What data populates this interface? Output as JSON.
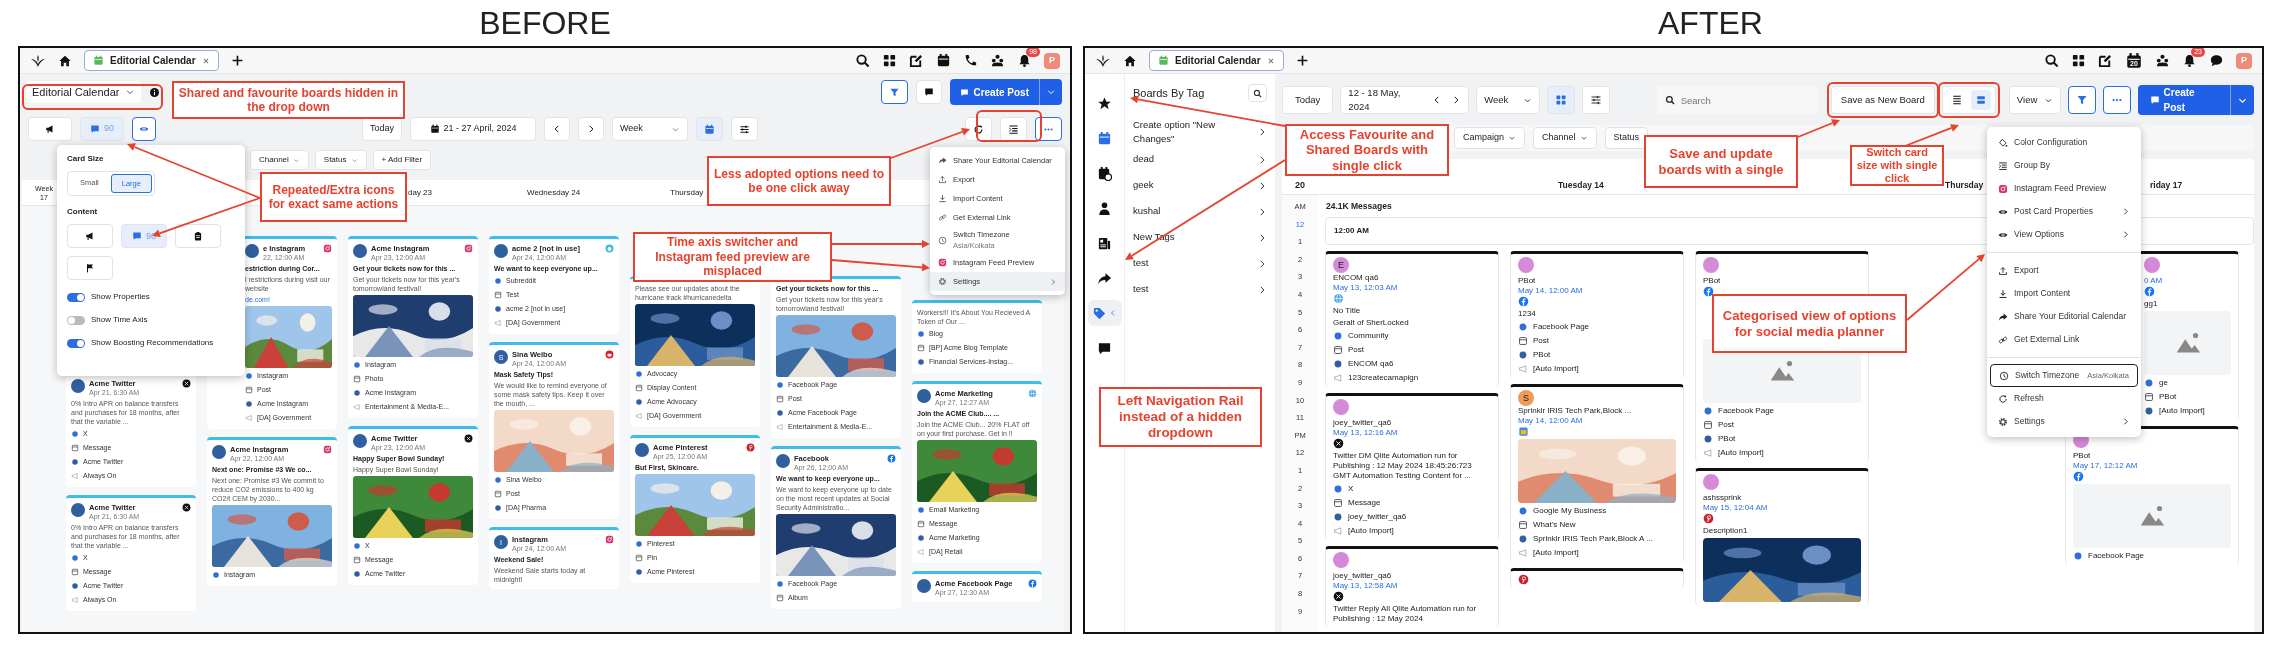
{
  "before": {
    "heading": "BEFORE",
    "topbar": {
      "tab": "Editorial Calendar",
      "badge": "98",
      "avatar": "P"
    },
    "board_selector": "Editorial Calendar",
    "content_buttons": [
      {
        "kind": "megaphone",
        "selected": false
      },
      {
        "kind": "comment",
        "count": "90",
        "selected": false
      },
      {
        "kind": "eye",
        "selected": true
      }
    ],
    "today": "Today",
    "date_range": "21 - 27 April, 2024",
    "view": "Week",
    "create_post": "Create Post",
    "filters": [
      "Channel",
      "Status",
      "+ Add Filter"
    ],
    "week": {
      "label": "Week",
      "number": "17"
    },
    "days": [
      "day 23",
      "Wednesday 24",
      "Thursday"
    ],
    "columns": [
      [
        {
          "name": "Acme Twitter",
          "date": "Apr 21, 6:30 AM",
          "kind": "x",
          "body": "0% Intro APR on balance transfers and purchases for 18 months, after that the variable ...",
          "props": [
            "X",
            "Message",
            "Acme Twitter",
            "Always On"
          ]
        },
        {
          "name": "Acme Twitter",
          "date": "Apr 21, 6:30 AM",
          "kind": "x",
          "body": "0% Intro APR on balance transfers and purchases for 18 months, after that the variable ...",
          "props": [
            "X",
            "Message",
            "Acme Twitter",
            "Always On"
          ]
        }
      ],
      [
        {
          "name": "e Instagram",
          "date": "22, 12:00 AM",
          "kind": "instagram",
          "title": "estriction during Cor...",
          "body": "l restrictions during visit our website",
          "link": "de.com!",
          "media": {
            "kind": "picture"
          },
          "props": [
            "Instagram",
            "Post",
            "Acme Instagram",
            "[DA] Government"
          ]
        },
        {
          "name": "Acme Instagram",
          "date": "Apr 22, 12:00 AM",
          "kind": "instagram",
          "title": "Next one: Promise #3 We co...",
          "body": "Next one: Promise #3 We commit to reduce CO2 emissions to 400 kg CO2/t CEM by 2030...",
          "media": {
            "kind": "picture"
          },
          "props": [
            "Instagram"
          ]
        }
      ],
      [
        {
          "name": "Acme Instagram",
          "date": "Apr 23, 12:00 AM",
          "kind": "instagram",
          "title": "Get your tickets now for this ...",
          "body": "Get your tickets now for this year's tomorrowland festival!",
          "media": {
            "kind": "picture"
          },
          "props": [
            "Instagram",
            "Photo",
            "Acme Instagram",
            "Entertainment & Media-E..."
          ]
        },
        {
          "name": "Acme Twitter",
          "date": "Apr 23, 12:00 AM",
          "kind": "x",
          "title": "Happy Super Bowl Sunday!",
          "body": "Happy Super Bowl Sunday!",
          "media": {
            "kind": "picture"
          },
          "props": [
            "X",
            "Message",
            "Acme Twitter"
          ]
        }
      ],
      [
        {
          "name": "acme 2 [not in use]",
          "date": "Apr 24, 12:00 AM",
          "kind": "reddit",
          "title": "We want to keep everyone up...",
          "props": [
            "Subreddit",
            "Test",
            "acme 2 [not in use]",
            "[DA] Government"
          ]
        },
        {
          "name": "Sina Weibo",
          "date": "Apr 24, 12:00 AM",
          "kind": "weibo",
          "avatar": "S",
          "title": "Mask Safety Tips!",
          "body": "We would like to remind everyone of some mask safety tips. Keep it over the mouth, ...",
          "media": {
            "kind": "picture"
          },
          "props": [
            "Sina Weibo",
            "Post",
            "[DA] Pharma"
          ]
        },
        {
          "name": "Instagram",
          "date": "Apr 24, 12:00 AM",
          "kind": "instagram",
          "avatar": "I",
          "title": "Weekend Sale!",
          "body": "Weekend Sale starts today at midnight!"
        }
      ],
      [
        {
          "body": "Please see our updates about the hurricane track #hurricanedelta",
          "media": {
            "kind": "picture"
          },
          "props": [
            "Advocacy",
            "Display Content",
            "Acme Advocacy",
            "[DA] Government"
          ]
        },
        {
          "name": "Acme Pinterest",
          "date": "Apr 25, 12:00 AM",
          "kind": "pinterest",
          "title": "But First, Skincare.",
          "media": {
            "kind": "picture"
          },
          "props": [
            "Pinterest",
            "Pin",
            "Acme Pinterest"
          ]
        }
      ],
      [
        {
          "title": "Get your tickets now for this ...",
          "body": "Get your tickets now for this year's tomorrowland festival!",
          "media": {
            "kind": "picture"
          },
          "props": [
            "Facebook Page",
            "Post",
            "Acme Facebook Page",
            "Entertainment & Media-E..."
          ]
        },
        {
          "name": "Facebook",
          "date": "Apr 26, 12:00 AM",
          "kind": "facebook",
          "title": "We want to keep everyone up...",
          "body": "We want to keep everyone up to date on the most recent updates at Social Security Administratio...",
          "media": {
            "kind": "picture"
          },
          "props": [
            "Facebook Page",
            "Album"
          ]
        }
      ],
      [
        {
          "body": "Workers!!! It's About You Recieved A Token of Our ...",
          "props": [
            "Blog",
            "[BP] Acme Blog Template",
            "Financial Services-Instag..."
          ]
        },
        {
          "name": "Acme Marketing",
          "date": "Apr 27, 12:27 AM",
          "kind": "globe",
          "title": "Join the ACME Club.... ...",
          "body": "Join the ACME Club... 20% FLAT off on your first purchase. Get in !!",
          "media": {
            "kind": "picture"
          },
          "props": [
            "Email Marketing",
            "Message",
            "Acme Marketing",
            "[DA] Retail"
          ]
        },
        {
          "name": "Acme Facebook Page",
          "date": "Apr 27, 12:30 AM",
          "kind": "facebook"
        }
      ]
    ],
    "card_popover": {
      "size_label": "Card Size",
      "sizes": [
        {
          "label": "Small",
          "selected": false
        },
        {
          "label": "Large",
          "selected": true
        }
      ],
      "content_label": "Content",
      "content_buttons": [
        {
          "kind": "megaphone",
          "selected": false
        },
        {
          "kind": "comment",
          "count": "90",
          "selected": true
        },
        {
          "kind": "clipboard",
          "selected": false
        },
        {
          "kind": "flag",
          "selected": false
        }
      ],
      "toggles": [
        {
          "label": "Show Properties",
          "on": true
        },
        {
          "label": "Show Time Axis",
          "on": false
        },
        {
          "label": "Show Boosting Recommendations",
          "on": true
        }
      ]
    },
    "menu": [
      {
        "kind": "share",
        "label": "Share Your Editorial Calendar",
        "selected": false
      },
      {
        "kind": "upload",
        "label": "Export",
        "selected": false
      },
      {
        "kind": "download",
        "label": "Import Content",
        "selected": false
      },
      {
        "kind": "link",
        "label": "Get External Link",
        "selected": false
      },
      {
        "kind": "clock",
        "label": "Switch Timezone",
        "sub": "Asia/Kolkata",
        "selected": false
      },
      {
        "kind": "instagram",
        "label": "Instagram Feed Preview",
        "selected": false
      },
      {
        "kind": "gear",
        "label": "Settings",
        "submenu": true,
        "selected": true
      }
    ],
    "annotations": [
      "Shared and favourite boards hidden in the drop down",
      "Repeated/Extra icons for exact same actions",
      "Less adopted options need to be one click away",
      "Time axis switcher and Instagram feed preview are misplaced"
    ]
  },
  "after": {
    "heading": "AFTER",
    "topbar": {
      "tab": "Editorial Calendar",
      "badge": "23",
      "avatar": "P",
      "calendar_day": "20"
    },
    "rail": [
      {
        "kind": "star",
        "selected": false
      },
      {
        "kind": "calendar",
        "selected": false
      },
      {
        "kind": "calendar-clock",
        "selected": false
      },
      {
        "kind": "person",
        "selected": false
      },
      {
        "kind": "news",
        "selected": false
      },
      {
        "kind": "share",
        "selected": false
      },
      {
        "kind": "tag",
        "selected": true
      },
      {
        "kind": "chat",
        "selected": false
      }
    ],
    "sidebar": {
      "title": "Boards By Tag",
      "items": [
        "Create option \"New Changes\"",
        "dead",
        "geek",
        "kushal",
        "New Tags",
        "test",
        "test"
      ]
    },
    "today": "Today",
    "date_range": "12 - 18 May, 2024",
    "view": "Week",
    "layout_buttons": [
      {
        "kind": "grid",
        "selected": true
      },
      {
        "kind": "sliders",
        "selected": false
      }
    ],
    "search": {
      "placeholder": "Search"
    },
    "save_board": "Save as New Board",
    "size_buttons": [
      {
        "kind": "compact",
        "selected": false
      },
      {
        "kind": "large",
        "selected": true
      }
    ],
    "view_menu": "View",
    "create_post": "Create Post",
    "filters": [
      "Campaign",
      "Channel",
      "Status"
    ],
    "week": "20",
    "days": [
      "Tuesday 14",
      "Thursday",
      "riday 17"
    ],
    "time_axis": [
      {
        "label": "AM",
        "current": false
      },
      {
        "label": "12",
        "current": true
      },
      {
        "label": "1",
        "current": false
      },
      {
        "label": "2",
        "current": false
      },
      {
        "label": "3",
        "current": false
      },
      {
        "label": "4",
        "current": false
      },
      {
        "label": "5",
        "current": false
      },
      {
        "label": "6",
        "current": false
      },
      {
        "label": "7",
        "current": false
      },
      {
        "label": "8",
        "current": false
      },
      {
        "label": "9",
        "current": false
      },
      {
        "label": "10",
        "current": false
      },
      {
        "label": "11",
        "current": false
      },
      {
        "label": "PM",
        "current": false
      },
      {
        "label": "12",
        "current": false
      },
      {
        "label": "1",
        "current": false
      },
      {
        "label": "2",
        "current": false
      },
      {
        "label": "3",
        "current": false
      },
      {
        "label": "4",
        "current": false
      },
      {
        "label": "5",
        "current": false
      },
      {
        "label": "6",
        "current": false
      },
      {
        "label": "7",
        "current": false
      },
      {
        "label": "8",
        "current": false
      },
      {
        "label": "9",
        "current": false
      }
    ],
    "summary": "24.1K Messages",
    "all_day": "12:00 AM",
    "columns": [
      [
        {
          "name": "ENCOM qa6",
          "date": "May 13, 12:03 AM",
          "avatar": "E",
          "kind": "globe",
          "title": "No Title",
          "body": "Geralt of SherLocked",
          "props": [
            "Community",
            "Post",
            "ENCOM qa6",
            "123createcamapign"
          ]
        },
        {
          "name": "joey_twitter_qa6",
          "date": "May 13, 12:16 AM",
          "kind": "x",
          "body": "Twitter DM Qlite Automation run for Publishing : 12 May 2024 18:45:26:723 GMT Automation Testing Content for ...",
          "props": [
            "X",
            "Message",
            "joey_twitter_qa6",
            "[Auto Import]"
          ]
        },
        {
          "name": "joey_twitter_qa6",
          "date": "May 13, 12:58 AM",
          "kind": "x",
          "body": "Twitter Reply All Qlite Automation run for Publishing : 12 May 2024"
        }
      ],
      [
        {
          "name": "PBot",
          "date": "May 14, 12:00 AM",
          "kind": "facebook",
          "body": "1234",
          "props": [
            "Facebook Page",
            "Post",
            "PBot",
            "[Auto Import]"
          ]
        },
        {
          "name": "Sprinklr IRIS Tech Park,Block ...",
          "date": "May 14, 12:00 AM",
          "avatar": "S",
          "kind": "gmb",
          "media": {
            "kind": "picture"
          },
          "props": [
            "Google My Business",
            "What's New",
            "Sprinklr IRIS Tech Park,Block A ...",
            "[Auto Import]"
          ]
        },
        {
          "kind": "pinterest"
        }
      ],
      [
        {
          "name": "PBot",
          "kind": "facebook",
          "media": {
            "kind": "placeholder"
          },
          "props": [
            "Facebook Page",
            "Post",
            "PBot",
            "[Auto Import]"
          ]
        },
        {
          "name": "ashssprink",
          "date": "May 15, 12:04 AM",
          "kind": "pinterest",
          "body": "Description1",
          "media": {
            "kind": "picture"
          }
        }
      ],
      [],
      [
        {
          "date": "0 AM",
          "kind": "facebook",
          "body": "gg1",
          "media": {
            "kind": "placeholder"
          },
          "props": [
            "ge",
            "PBot",
            "[Auto Import]"
          ]
        },
        {
          "name": "PBot",
          "date": "May 17, 12:12 AM",
          "kind": "facebook",
          "media": {
            "kind": "placeholder"
          },
          "props": [
            "Facebook Page"
          ]
        }
      ]
    ],
    "menu": [
      [
        {
          "kind": "paint",
          "label": "Color Configuration",
          "selected": false
        },
        {
          "kind": "list",
          "label": "Group By",
          "selected": false
        },
        {
          "kind": "instagram",
          "label": "Instagram Feed Preview",
          "selected": false
        },
        {
          "kind": "eye",
          "label": "Post Card Properties",
          "submenu": true,
          "selected": false
        },
        {
          "kind": "eye",
          "label": "View Options",
          "submenu": true,
          "selected": false
        }
      ],
      [
        {
          "kind": "upload",
          "label": "Export",
          "selected": false
        },
        {
          "kind": "download",
          "label": "Import Content",
          "selected": false
        },
        {
          "kind": "share",
          "label": "Share Your Editorial Calendar",
          "selected": false
        },
        {
          "kind": "link",
          "label": "Get External Link",
          "selected": false
        }
      ],
      [
        {
          "kind": "clock",
          "label": "Switch Timezone",
          "sub": "Asia/Kolkata",
          "selected": true
        },
        {
          "kind": "refresh",
          "label": "Refresh",
          "selected": false
        },
        {
          "kind": "gear",
          "label": "Settings",
          "submenu": true,
          "selected": false
        }
      ]
    ],
    "annotations": [
      "Access Favourite and Shared Boards with single click",
      "Left Navigation Rail instead of a hidden dropdown",
      "Save and update boards with a single",
      "Switch card size with single click",
      "Categorised view of options for social media planner"
    ]
  }
}
